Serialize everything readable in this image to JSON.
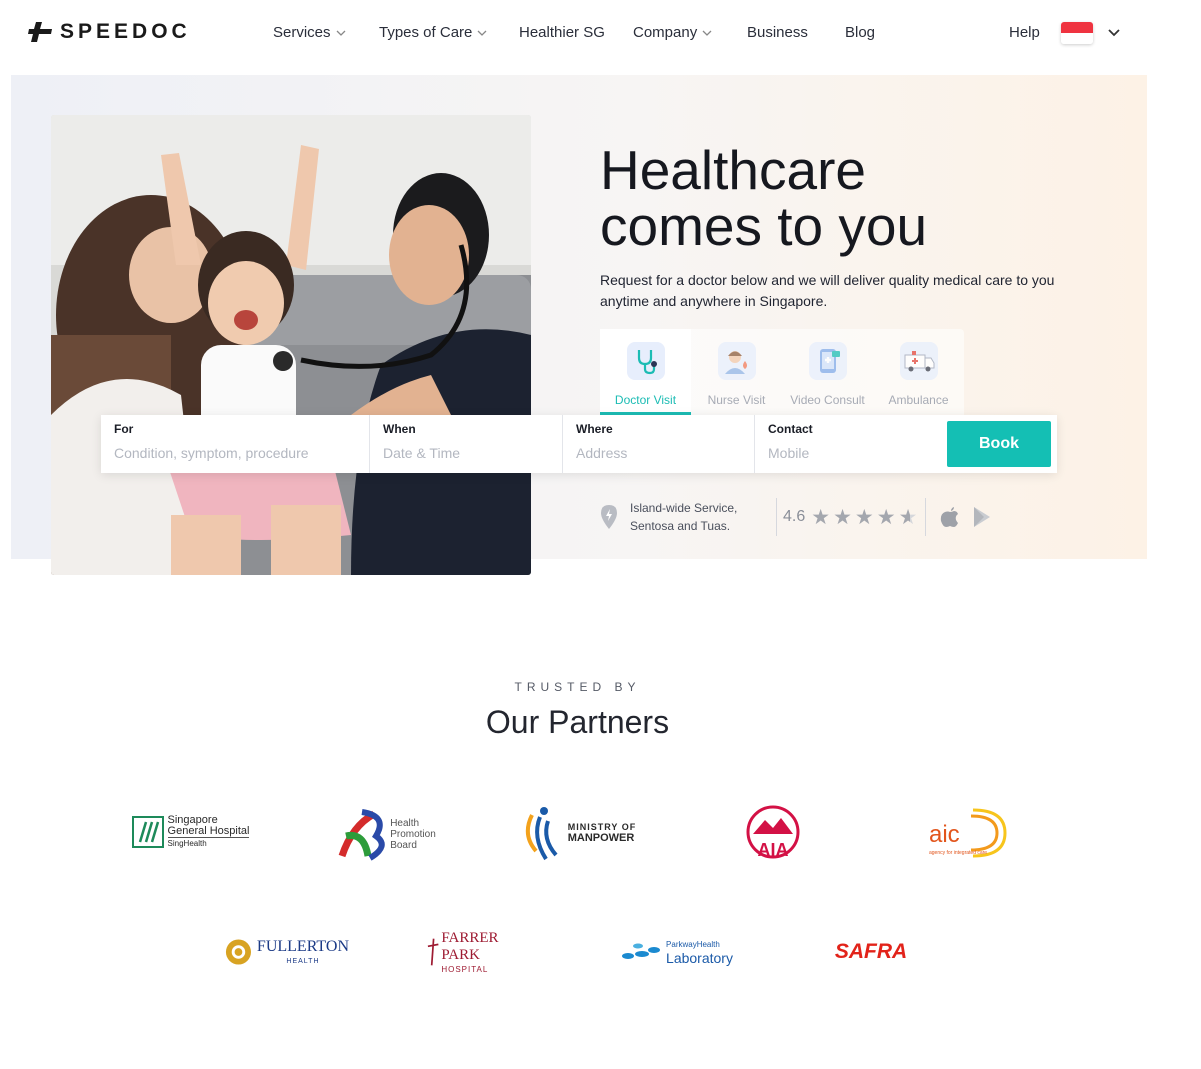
{
  "header": {
    "brand": "SPEEDOC",
    "nav": [
      {
        "label": "Services",
        "has_dropdown": true
      },
      {
        "label": "Types of Care",
        "has_dropdown": true
      },
      {
        "label": "Healthier SG",
        "has_dropdown": false
      },
      {
        "label": "Company",
        "has_dropdown": true
      },
      {
        "label": "Business",
        "has_dropdown": false
      },
      {
        "label": "Blog",
        "has_dropdown": false
      }
    ],
    "help": "Help",
    "country_flag": "singapore-flag-icon"
  },
  "hero": {
    "title_line1": "Healthcare",
    "title_line2": "comes to you",
    "subtitle": "Request for a doctor below and we will deliver quality medical care to you anytime and anywhere in Singapore.",
    "tabs": [
      {
        "label": "Doctor Visit",
        "icon": "stethoscope-icon",
        "active": true
      },
      {
        "label": "Nurse Visit",
        "icon": "nurse-icon",
        "active": false
      },
      {
        "label": "Video Consult",
        "icon": "video-consult-icon",
        "active": false
      },
      {
        "label": "Ambulance",
        "icon": "ambulance-icon",
        "active": false
      }
    ],
    "form": {
      "for_label": "For",
      "for_placeholder": "Condition, symptom, procedure",
      "when_label": "When",
      "when_placeholder": "Date & Time",
      "where_label": "Where",
      "where_placeholder": "Address",
      "contact_label": "Contact",
      "contact_placeholder": "Mobile",
      "book_label": "Book"
    },
    "service_area": "Island-wide Service, Sentosa and Tuas.",
    "rating": "4.6",
    "rating_value": 4.6,
    "accent_color": "#14bfb4"
  },
  "partners": {
    "eyebrow": "TRUSTED BY",
    "title": "Our Partners",
    "logos": {
      "sgh_line1": "Singapore",
      "sgh_line2": "General Hospital",
      "sgh_line3": "SingHealth",
      "hpb_line1": "Health",
      "hpb_line2": "Promotion",
      "hpb_line3": "Board",
      "mom_line1": "MINISTRY OF",
      "mom_line2": "MANPOWER",
      "aia": "AIA",
      "aic": "aic",
      "aic_tag": "agency for integrated care",
      "fullerton_line1": "FULLERTON",
      "fullerton_line2": "HEALTH",
      "farrer_line1": "FARRER PARK",
      "farrer_line2": "HOSPITAL",
      "parkway_line1": "ParkwayHealth",
      "parkway_line2": "Laboratory",
      "safra": "SAFRA"
    }
  }
}
